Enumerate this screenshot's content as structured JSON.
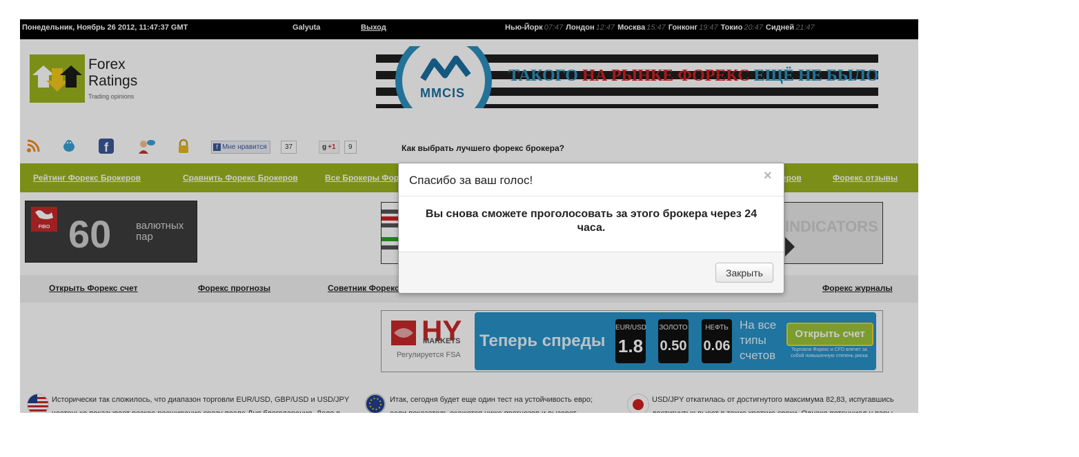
{
  "topbar": {
    "datetime": "Понедельник, Ноябрь 26 2012, 11:47:37 GMT",
    "username": "Galyuta",
    "logout": "Выход",
    "cities": [
      {
        "name": "Нью-Йорк",
        "time": "07:47"
      },
      {
        "name": "Лондон",
        "time": "12:47"
      },
      {
        "name": "Москва",
        "time": "15:47"
      },
      {
        "name": "Гонконг",
        "time": "19:47"
      },
      {
        "name": "Токио",
        "time": "20:47"
      },
      {
        "name": "Сидней",
        "time": "21:47"
      }
    ]
  },
  "logo": {
    "line1": "Forex",
    "line2": "Ratings",
    "tagline": "Trading opinions"
  },
  "banner": {
    "brand": "MMCIS",
    "text_a": "ТАКОГО ",
    "text_b": "НА РЫНКЕ ФОРЕКС",
    "text_c": " ЕЩЁ НЕ БЫЛО!"
  },
  "social": {
    "like_label": "Мне нравится",
    "like_count": "37",
    "gplus_label": "+1",
    "gplus_count": "9",
    "howto_link": "Как выбрать лучшего форекс брокера?"
  },
  "mainnav": [
    "Рейтинг Форекс Брокеров",
    "Сравнить Форекс Брокеров",
    "Все Брокеры Форекс",
    "еров",
    "Форекс отзывы"
  ],
  "fibo": {
    "badge": "FIBO",
    "number": "60",
    "text": "валютных пар"
  },
  "midad": {
    "text": "INDICATORS"
  },
  "subnav": [
    "Открыть Форекс счет",
    "Форекс прогнозы",
    "Советник Форекс",
    "Форекс журналы"
  ],
  "hyad": {
    "logo": "HY",
    "markets": "MARKETS",
    "regulated": "Регулируется FSA",
    "headline": "Теперь спреды",
    "boxes": [
      {
        "label": "EUR/USD",
        "value": "1.8"
      },
      {
        "label": "ЗОЛОТО",
        "value": "0.50"
      },
      {
        "label": "НЕФТЬ",
        "value": "0.06"
      }
    ],
    "side": "На все типы счетов",
    "button": "Открыть счет",
    "fine": "Торговля Форекс и CFD влечет за собой повышенную степень риска"
  },
  "news": [
    {
      "line1": "Исторически так сложилось, что диапазон торговли EUR/USD, GBP/USD и USD/JPY",
      "line2": "частенько показывает резкое расширение сразу после Дня благодарения. Дело в"
    },
    {
      "line1": "Итак, сегодня будет еще один тест на устойчивость евро;",
      "line2": "если показатель окажется ниже прогнозов и вызовет"
    },
    {
      "line1": "USD/JPY откатилась от достигнутого максимума 82,83, испугавшись",
      "line2": "достигнутых высот в такие краткие сроки. Однако потенциал у пары"
    }
  ],
  "modal": {
    "title": "Спасибо за ваш голос!",
    "close_glyph": "×",
    "body": "Вы снова сможете проголосовать за этого брокера через 24 часа.",
    "button": "Закрыть"
  },
  "colors": {
    "green_nav": "#9ab21d",
    "top_bar": "#000000",
    "banner_blue": "#2c8fbf",
    "banner_red": "#d02020",
    "hy_blue": "#2792c9"
  }
}
